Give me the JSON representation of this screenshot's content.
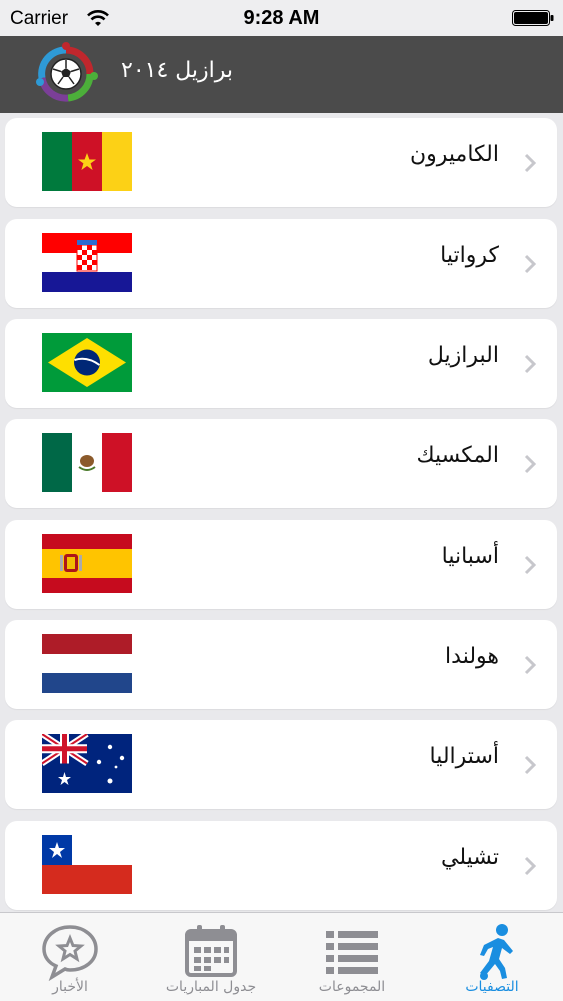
{
  "status_bar": {
    "carrier": "Carrier",
    "time": "9:28 AM"
  },
  "nav": {
    "title": "برازيل ٢٠١٤"
  },
  "countries": [
    {
      "name": "الكاميرون",
      "flag": "cameroon-flag"
    },
    {
      "name": "كرواتيا",
      "flag": "croatia-flag"
    },
    {
      "name": "البرازيل",
      "flag": "brazil-flag"
    },
    {
      "name": "المكسيك",
      "flag": "mexico-flag"
    },
    {
      "name": "أسبانيا",
      "flag": "spain-flag"
    },
    {
      "name": "هولندا",
      "flag": "netherlands-flag"
    },
    {
      "name": "أستراليا",
      "flag": "australia-flag"
    },
    {
      "name": "تشيلي",
      "flag": "chile-flag"
    }
  ],
  "tabs": [
    {
      "label": "الأخبار",
      "icon": "news-chat-star-icon",
      "active": false
    },
    {
      "label": "جدول المباريات",
      "icon": "calendar-icon",
      "active": false
    },
    {
      "label": "المجموعات",
      "icon": "list-icon",
      "active": false
    },
    {
      "label": "التصفيات",
      "icon": "football-player-icon",
      "active": true
    }
  ],
  "colors": {
    "accent": "#1a8ee0",
    "nav_bg": "#4b4b4b",
    "inactive": "#8e8e93"
  }
}
